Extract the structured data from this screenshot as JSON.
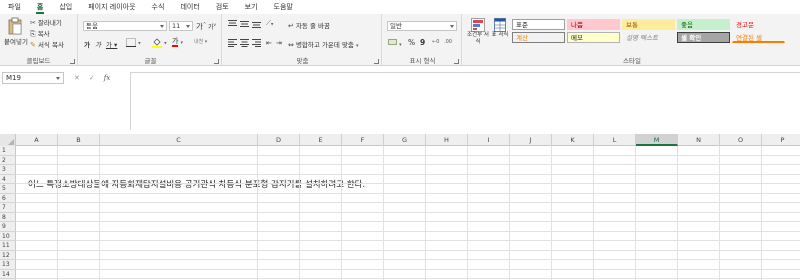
{
  "menu": {
    "tabs": [
      "파일",
      "홈",
      "삽입",
      "페이지 레이아웃",
      "수식",
      "데이터",
      "검토",
      "보기",
      "도움말"
    ],
    "active_tab": "홈"
  },
  "ribbon": {
    "clipboard": {
      "label": "클립보드",
      "paste": "붙여넣기",
      "cut": "잘라내기",
      "copy": "복사",
      "format_painter": "서식 복사"
    },
    "font": {
      "label": "글꼴",
      "font_name": "돋움",
      "font_size": "11",
      "grow": "가",
      "shrink": "가",
      "bold": "가",
      "italic": "가",
      "underline": "가",
      "font_color_glyph": "가",
      "phonetic": "내천"
    },
    "alignment": {
      "label": "맞춤",
      "wrap_text": "자동 줄 바꿈",
      "merge_center": "병합하고 가운데 맞춤"
    },
    "number": {
      "label": "표시 형식",
      "format": "일반",
      "percent": "%",
      "comma": "9"
    },
    "styles": {
      "label": "스타일",
      "conditional": "조건부 서식",
      "table": "표 서식",
      "cells": [
        {
          "text": "표준",
          "bg": "#ffffff",
          "color": "#222222",
          "border": "#9e9e9e"
        },
        {
          "text": "나쁨",
          "bg": "#ffc7ce",
          "color": "#9c0006",
          "border": "#ffc7ce"
        },
        {
          "text": "보통",
          "bg": "#ffeb9c",
          "color": "#9c5700",
          "border": "#ffeb9c"
        },
        {
          "text": "좋음",
          "bg": "#c6efce",
          "color": "#006100",
          "border": "#c6efce"
        },
        {
          "text": "경고문",
          "bg": "#f3f3f3",
          "color": "#ff0000",
          "border": "#f3f3f3"
        },
        {
          "text": "계산",
          "bg": "#f2f2f2",
          "color": "#fa7d00",
          "border": "#7f7f7f"
        },
        {
          "text": "메모",
          "bg": "#ffffcc",
          "color": "#222222",
          "border": "#b2b2b2"
        },
        {
          "text": "설명 텍스트",
          "bg": "#f3f3f3",
          "color": "#7f7f7f",
          "border": "#f3f3f3"
        },
        {
          "text": "셀 확인",
          "bg": "#a5a5a5",
          "color": "#ffffff",
          "border": "#3f3f3f"
        },
        {
          "text": "연결된 셀",
          "bg": "#f3f3f3",
          "color": "#fa7d00",
          "border": "#f3f3f3"
        }
      ]
    }
  },
  "formula_bar": {
    "name_box": "M19",
    "cancel": "✕",
    "enter": "✓",
    "fx": "fx",
    "content": ""
  },
  "sheet": {
    "columns": [
      "A",
      "B",
      "C",
      "D",
      "E",
      "F",
      "G",
      "H",
      "I",
      "J",
      "K",
      "L",
      "M",
      "N",
      "O",
      "P"
    ],
    "active_column": "M",
    "rows": [
      "1",
      "2",
      "3",
      "4",
      "5",
      "6",
      "7",
      "8",
      "9",
      "10",
      "11",
      "12",
      "13",
      "14"
    ],
    "cell_c5": "어느 특정소방대상물에 자동화재탐지설비용 공기관식 차동식 분포형 감지기를 설치하려고 한다."
  },
  "colors": {
    "accent": "#1f7244"
  }
}
